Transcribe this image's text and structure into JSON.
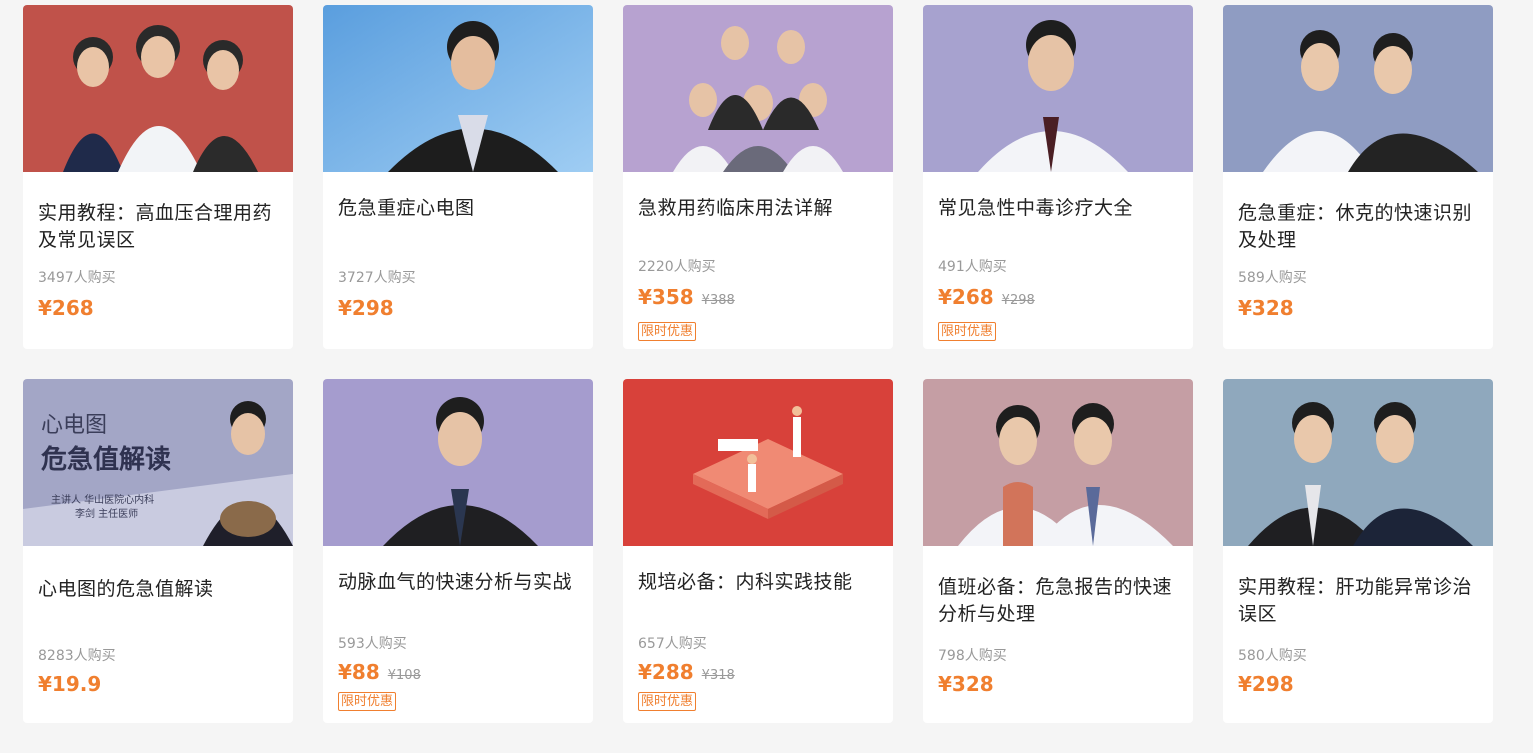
{
  "courses": [
    {
      "title": "实用教程：高血压合理用药及常见误区",
      "sales": "3497人购买",
      "price": "¥268",
      "orig": "",
      "promo": "",
      "bg": "#c0524a"
    },
    {
      "title": "危急重症心电图",
      "sales": "3727人购买",
      "price": "¥298",
      "orig": "",
      "promo": "",
      "bg": "#7bb4e4"
    },
    {
      "title": "急救用药临床用法详解",
      "sales": "2220人购买",
      "price": "¥358",
      "orig": "¥388",
      "promo": "限时优惠",
      "bg": "#b7a2d0"
    },
    {
      "title": "常见急性中毒诊疗大全",
      "sales": "491人购买",
      "price": "¥268",
      "orig": "¥298",
      "promo": "限时优惠",
      "bg": "#a7a2cf"
    },
    {
      "title": "危急重症：休克的快速识别及处理",
      "sales": "589人购买",
      "price": "¥328",
      "orig": "",
      "promo": "",
      "bg": "#8f9cc2"
    },
    {
      "title": "心电图的危急值解读",
      "sales": "8283人购买",
      "price": "¥19.9",
      "orig": "",
      "promo": "",
      "bg": "#9ea2c2"
    },
    {
      "title": "动脉血气的快速分析与实战",
      "sales": "593人购买",
      "price": "¥88",
      "orig": "¥108",
      "promo": "限时优惠",
      "bg": "#a59cce"
    },
    {
      "title": "规培必备：内科实践技能",
      "sales": "657人购买",
      "price": "¥288",
      "orig": "¥318",
      "promo": "限时优惠",
      "bg": "#d8413a"
    },
    {
      "title": "值班必备：危急报告的快速分析与处理",
      "sales": "798人购买",
      "price": "¥328",
      "orig": "",
      "promo": "",
      "bg": "#c59ea4"
    },
    {
      "title": "实用教程：肝功能异常诊治误区",
      "sales": "580人购买",
      "price": "¥298",
      "orig": "",
      "promo": "",
      "bg": "#8fa8bd"
    }
  ],
  "banner6": {
    "line1": "心电图",
    "line2": "危急值解读",
    "line3": "主讲人  华山医院心内科",
    "line4": "李剑 主任医师"
  }
}
